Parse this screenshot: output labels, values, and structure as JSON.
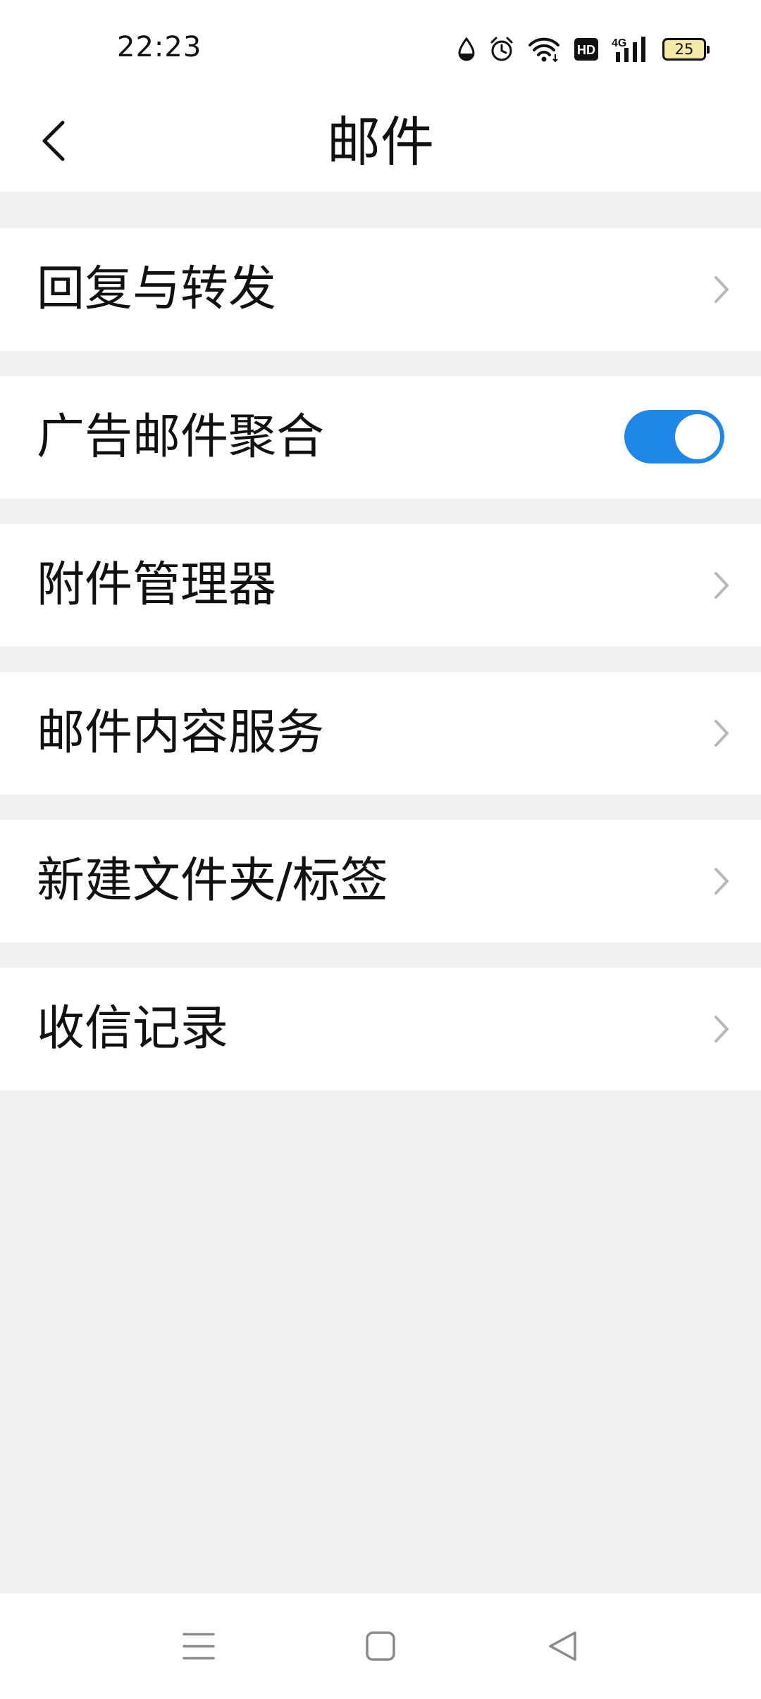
{
  "status_bar": {
    "time": "22:23",
    "icons": [
      "water-drop-icon",
      "alarm-icon",
      "wifi-icon",
      "hd-icon",
      "4g-signal-icon"
    ],
    "network": "4G",
    "hd_label": "HD",
    "battery_level": "25"
  },
  "header": {
    "title": "邮件",
    "back_icon": "chevron-left-icon"
  },
  "settings": {
    "items": [
      {
        "label": "回复与转发",
        "control": "chevron"
      },
      {
        "label": "广告邮件聚合",
        "control": "toggle",
        "toggle_on": true
      },
      {
        "label": "附件管理器",
        "control": "chevron"
      },
      {
        "label": "邮件内容服务",
        "control": "chevron"
      },
      {
        "label": "新建文件夹/标签",
        "control": "chevron"
      },
      {
        "label": "收信记录",
        "control": "chevron"
      }
    ]
  },
  "nav_bar": {
    "buttons": [
      "menu-icon",
      "home-icon",
      "back-triangle-icon"
    ]
  },
  "colors": {
    "accent": "#1f87e8",
    "background": "#f0f1f3",
    "surface": "#ffffff",
    "chevron": "#b8b8b8"
  }
}
